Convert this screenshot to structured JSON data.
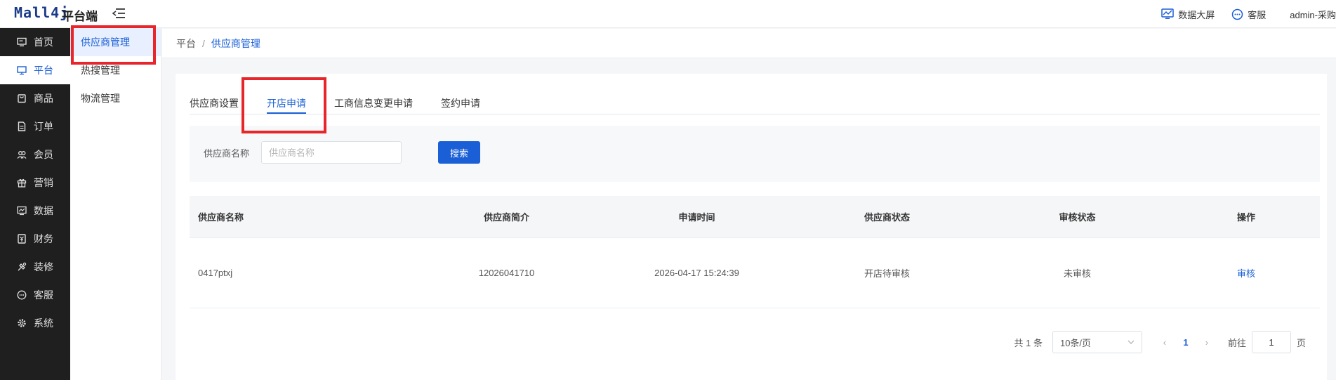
{
  "header": {
    "logo": "Mall4j",
    "logo_sub": "平台端",
    "data_screen": "数据大屏",
    "service": "客服",
    "user": "admin-采购"
  },
  "sidebar": {
    "items": [
      {
        "label": "首页",
        "icon": "monitor-icon"
      },
      {
        "label": "平台",
        "icon": "desktop-icon"
      },
      {
        "label": "商品",
        "icon": "bag-icon"
      },
      {
        "label": "订单",
        "icon": "document-icon"
      },
      {
        "label": "会员",
        "icon": "users-icon"
      },
      {
        "label": "营销",
        "icon": "gift-icon"
      },
      {
        "label": "数据",
        "icon": "chart-icon"
      },
      {
        "label": "财务",
        "icon": "finance-icon"
      },
      {
        "label": "装修",
        "icon": "decor-icon"
      },
      {
        "label": "客服",
        "icon": "chat-icon"
      },
      {
        "label": "系统",
        "icon": "gear-icon"
      }
    ],
    "active_index": 1
  },
  "subsidebar": {
    "items": [
      "供应商管理",
      "热搜管理",
      "物流管理"
    ],
    "active_index": 0
  },
  "breadcrumb": {
    "root": "平台",
    "separator": "/",
    "current": "供应商管理"
  },
  "tabs": [
    "供应商设置",
    "开店申请",
    "工商信息变更申请",
    "签约申请"
  ],
  "active_tab": 1,
  "search": {
    "label": "供应商名称",
    "placeholder": "供应商名称",
    "button": "搜索"
  },
  "table": {
    "columns": [
      "供应商名称",
      "供应商简介",
      "申请时间",
      "供应商状态",
      "审核状态",
      "操作"
    ],
    "rows": [
      [
        "0417ptxj",
        "12026041710",
        "2026-04-17 15:24:39",
        "开店待审核",
        "未审核",
        "审核"
      ]
    ]
  },
  "pagination": {
    "total": "共 1 条",
    "page_size": "10条/页",
    "current_page": "1",
    "goto_label": "前往",
    "goto_value": "1",
    "goto_suffix": "页"
  },
  "colors": {
    "accent": "#1a5fd6",
    "highlight": "#e8252a",
    "sidebar_bg": "#1f1f1f"
  }
}
